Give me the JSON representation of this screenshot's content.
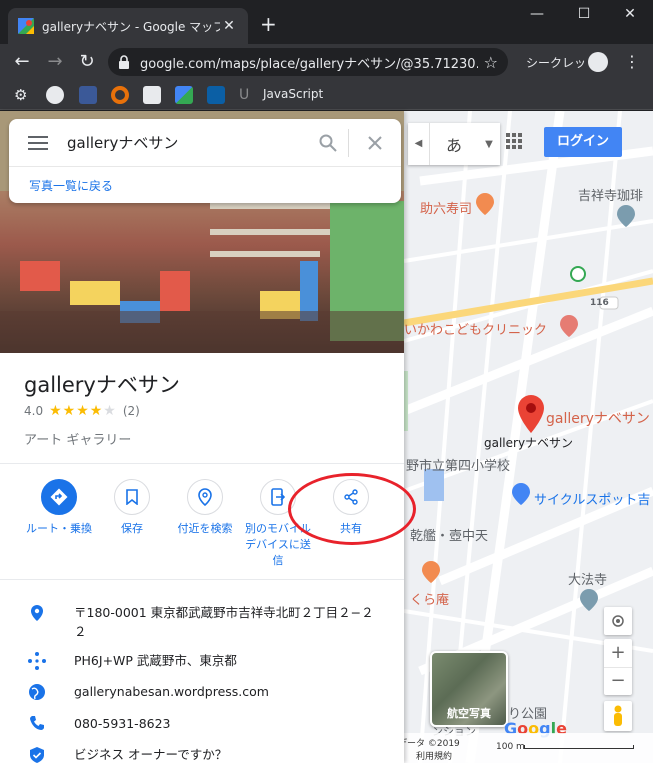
{
  "browser": {
    "tab_title": "galleryナベサン - Google マップ",
    "new_tab": "+",
    "url": "google.com/maps/place/galleryナベサン/@35.71230...",
    "incognito_label": "シークレット",
    "bookmark_label": "JavaScript",
    "window_controls": [
      "—",
      "☐",
      "✕"
    ]
  },
  "search": {
    "query": "galleryナベサン",
    "back_link": "写真一覧に戻る"
  },
  "place": {
    "name": "galleryナベサン",
    "rating": "4.0",
    "rating_value": 4,
    "review_count": "(2)",
    "category": "アート ギャラリー"
  },
  "actions": [
    {
      "label": "ルート・乗換",
      "icon": "directions-icon"
    },
    {
      "label": "保存",
      "icon": "bookmark-icon"
    },
    {
      "label": "付近を検索",
      "icon": "nearby-icon"
    },
    {
      "label": "別のモバイルデバイスに送信",
      "icon": "send-to-device-icon"
    },
    {
      "label": "共有",
      "icon": "share-icon"
    }
  ],
  "info": {
    "address": "〒180-0001 東京都武蔵野市吉祥寺北町２丁目２−２２",
    "plus_code": "PH6J+WP 武蔵野市、東京都",
    "website": "gallerynabesan.wordpress.com",
    "phone": "080-5931-8623",
    "business": "ビジネス オーナーですか？"
  },
  "map": {
    "lang": "あ",
    "login": "ログイン",
    "aerial_label": "航空写真",
    "pin_label": "galleryナベサン",
    "place_label": "galleryナベサン",
    "labels": {
      "sushi": "助六寿司",
      "cafe": "吉祥寺珈琲",
      "road": "116",
      "clinic": "いかわこどもクリニック",
      "school": "野市立第四小学校",
      "cycle": "サイクルスポット吉",
      "chuuten": "乾艦・壺中天",
      "temple": "大法寺",
      "kura": "くら庵",
      "park": "り公園",
      "station": "ンション"
    },
    "footer_data": "地図データ ©2019",
    "footer_country": "日本",
    "footer_terms": "利用規約",
    "footer_scale": "100 m",
    "google": "Google"
  },
  "colors": {
    "accent": "#1a73e8",
    "pin": "#ea4335",
    "highlight_ellipse": "#e8222b"
  }
}
